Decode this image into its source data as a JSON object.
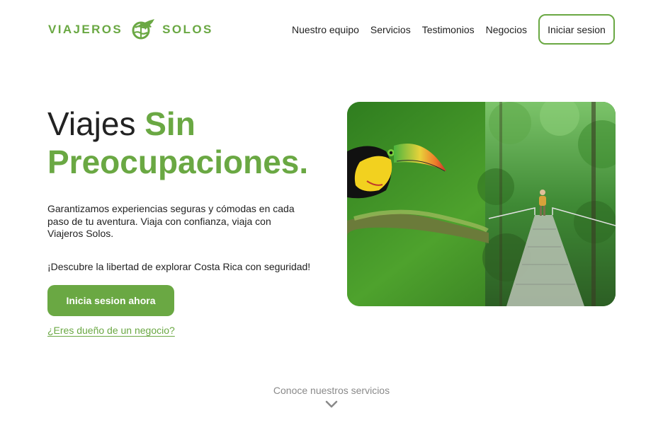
{
  "header": {
    "logo_left": "VIAJEROS",
    "logo_right": "SOLOS",
    "nav": [
      {
        "label": "Nuestro equipo"
      },
      {
        "label": "Servicios"
      },
      {
        "label": "Testimonios"
      },
      {
        "label": "Negocios"
      }
    ],
    "login_label": "Iniciar sesion"
  },
  "hero": {
    "title_plain": "Viajes ",
    "title_accent": "Sin Preocupaciones.",
    "description": "Garantizamos experiencias seguras y cómodas en cada paso de tu aventura. Viaja con confianza, viaja con Viajeros Solos.",
    "cta_text": "¡Descubre la libertad de explorar Costa Rica con seguridad!",
    "primary_button": "Inicia sesion ahora",
    "business_link": "¿Eres dueño de un negocio?"
  },
  "services": {
    "label": "Conoce nuestros servicios"
  },
  "colors": {
    "brand_green": "#6aa843",
    "text_dark": "#1f1f1f",
    "muted": "#8a8a8a"
  },
  "icons": {
    "logo": "globe-airplane-icon",
    "scroll": "chevron-down-icon"
  }
}
